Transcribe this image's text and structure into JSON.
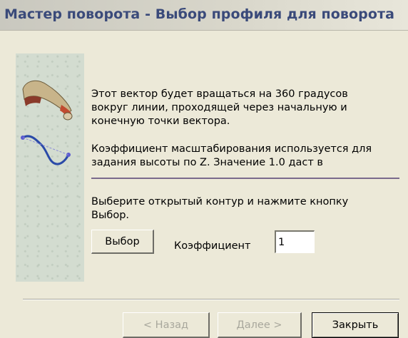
{
  "window": {
    "title": "Мастер поворота - Выбор профиля для поворота"
  },
  "description": {
    "paragraph1": "Этот вектор будет вращаться на 360 градусов вокруг линии, проходящей через начальную и конечную точки вектора.",
    "paragraph2": "Коэффициент масштабирования используется для задания высоты по Z. Значение 1.0 даст в"
  },
  "instruction": "Выберите открытый контур и нажмите кнопку Выбор.",
  "select_button": "Выбор",
  "coefficient": {
    "label": "Коэффициент",
    "value": "1"
  },
  "footer": {
    "back": "< Назад",
    "next": "Далее >",
    "close": "Закрыть"
  },
  "icons": {
    "graphic": "revolve-profile-illustration"
  }
}
